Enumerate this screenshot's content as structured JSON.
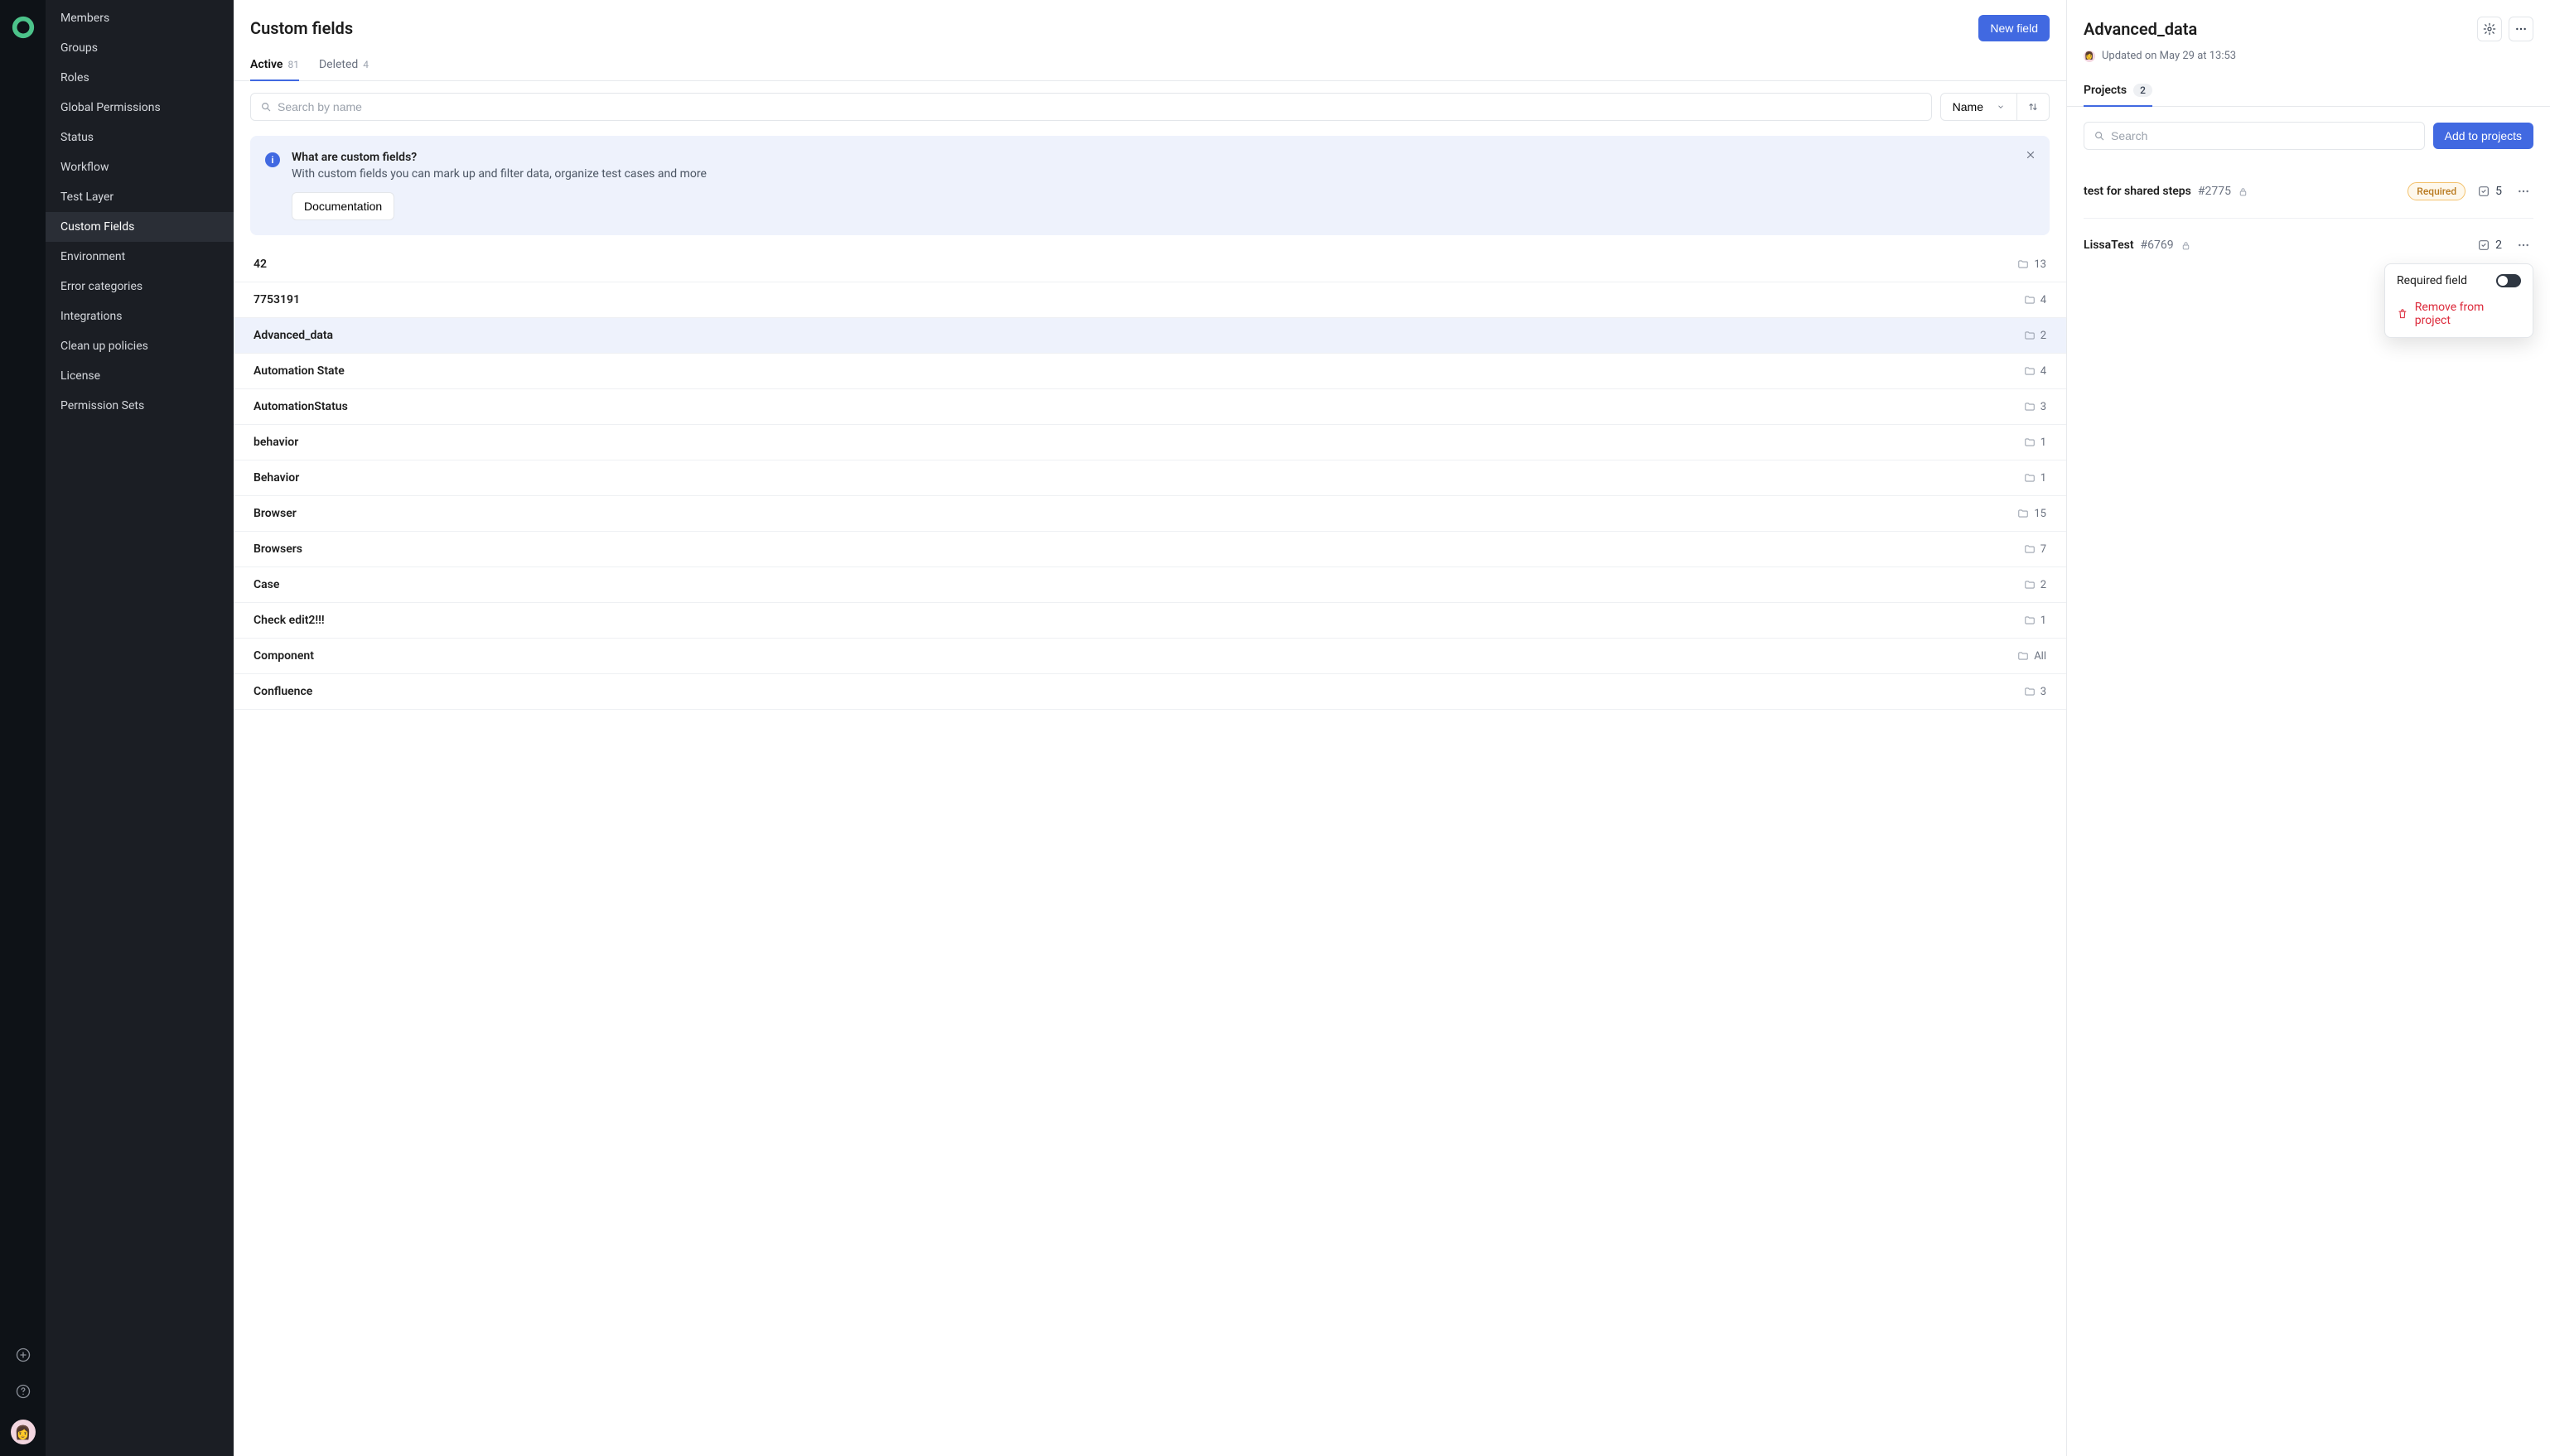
{
  "sidebar": {
    "items": [
      {
        "label": "Members"
      },
      {
        "label": "Groups"
      },
      {
        "label": "Roles"
      },
      {
        "label": "Global Permissions"
      },
      {
        "label": "Status"
      },
      {
        "label": "Workflow"
      },
      {
        "label": "Test Layer"
      },
      {
        "label": "Custom Fields"
      },
      {
        "label": "Environment"
      },
      {
        "label": "Error categories"
      },
      {
        "label": "Integrations"
      },
      {
        "label": "Clean up policies"
      },
      {
        "label": "License"
      },
      {
        "label": "Permission Sets"
      }
    ]
  },
  "center": {
    "title": "Custom fields",
    "new_field_label": "New field",
    "tabs": {
      "active_label": "Active",
      "active_count": "81",
      "deleted_label": "Deleted",
      "deleted_count": "4"
    },
    "search_placeholder": "Search by name",
    "sort_label": "Name",
    "banner": {
      "title": "What are custom fields?",
      "description": "With custom fields you can mark up and filter data, organize test cases and more",
      "doc_button": "Documentation"
    },
    "fields": [
      {
        "name": "42",
        "count": "13"
      },
      {
        "name": "7753191",
        "count": "4"
      },
      {
        "name": "Advanced_data",
        "count": "2"
      },
      {
        "name": "Automation State",
        "count": "4"
      },
      {
        "name": "AutomationStatus",
        "count": "3"
      },
      {
        "name": "behavior",
        "count": "1"
      },
      {
        "name": "Behavior",
        "count": "1"
      },
      {
        "name": "Browser",
        "count": "15"
      },
      {
        "name": "Browsers",
        "count": "7"
      },
      {
        "name": "Case",
        "count": "2"
      },
      {
        "name": "Check edit2!!!",
        "count": "1"
      },
      {
        "name": "Component",
        "count": "All"
      },
      {
        "name": "Confluence",
        "count": "3"
      }
    ]
  },
  "detail": {
    "title": "Advanced_data",
    "updated_text": "Updated on May 29 at 13:53",
    "tab_label": "Projects",
    "tab_count": "2",
    "search_placeholder": "Search",
    "add_button": "Add to projects",
    "projects": [
      {
        "name": "test for shared steps",
        "id": "#2775",
        "required_label": "Required",
        "test_count": "5"
      },
      {
        "name": "LissaTest",
        "id": "#6769",
        "test_count": "2"
      }
    ],
    "dropdown": {
      "required_label": "Required field",
      "remove_label": "Remove from project"
    }
  }
}
